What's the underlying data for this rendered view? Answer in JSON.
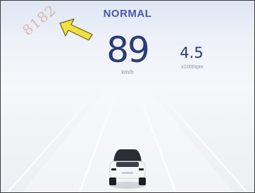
{
  "drive": {
    "mode": "NORMAL",
    "speed": "89",
    "speed_unit": "km/h",
    "rpm": "4.5",
    "rpm_unit": "x1000rpm"
  },
  "overlay": {
    "watermark": "8182",
    "pointer_arrow_color": "#f0e040"
  },
  "theme": {
    "accent": "#2c3a78",
    "mode_color": "#4a5aa8"
  },
  "icons": {
    "vehicle": "car-rear-icon",
    "pointer": "arrow-pointer-icon"
  }
}
